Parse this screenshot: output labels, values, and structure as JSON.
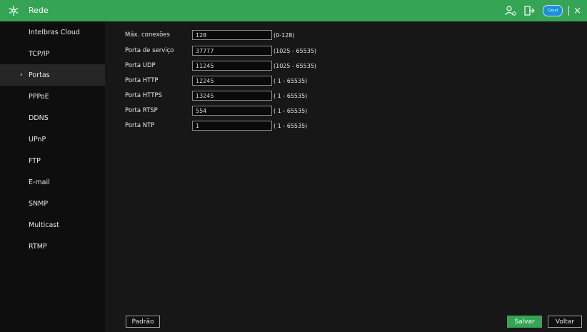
{
  "window": {
    "title": "Rede",
    "accent_color": "#36a455",
    "icons": {
      "app": "network-snowflake-icon",
      "user": "user-settings-icon",
      "logout": "logout-icon",
      "cloud": "cloud-status-icon",
      "close": "close-icon"
    },
    "cloud_label": "Cloud",
    "close_glyph": "×"
  },
  "sidebar": {
    "items": [
      {
        "label": "Intelbras Cloud",
        "active": false
      },
      {
        "label": "TCP/IP",
        "active": false
      },
      {
        "label": "Portas",
        "active": true
      },
      {
        "label": "PPPoE",
        "active": false
      },
      {
        "label": "DDNS",
        "active": false
      },
      {
        "label": "UPnP",
        "active": false
      },
      {
        "label": "FTP",
        "active": false
      },
      {
        "label": "E-mail",
        "active": false
      },
      {
        "label": "SNMP",
        "active": false
      },
      {
        "label": "Multicast",
        "active": false
      },
      {
        "label": "RTMP",
        "active": false
      }
    ],
    "active_marker": "›"
  },
  "form": {
    "rows": [
      {
        "label": "Máx. conexões",
        "value": "128",
        "range": "(0-128)"
      },
      {
        "label": "Porta de serviço",
        "value": "37777",
        "range": "(1025 - 65535)"
      },
      {
        "label": "Porta UDP",
        "value": "11245",
        "range": "(1025 - 65535)"
      },
      {
        "label": "Porta HTTP",
        "value": "12245",
        "range": "( 1 - 65535)"
      },
      {
        "label": "Porta HTTPS",
        "value": "13245",
        "range": "( 1 - 65535)"
      },
      {
        "label": "Porta RTSP",
        "value": "554",
        "range": "( 1 - 65535)"
      },
      {
        "label": "Porta NTP",
        "value": "1",
        "range": "( 1 - 65535)"
      }
    ]
  },
  "footer": {
    "default_label": "Padrão",
    "save_label": "Salvar",
    "back_label": "Voltar"
  }
}
